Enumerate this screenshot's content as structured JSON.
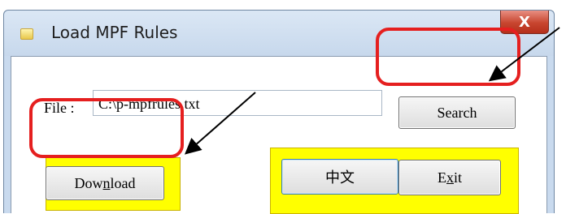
{
  "window": {
    "title": "Load MPF Rules",
    "close_glyph": "X"
  },
  "form": {
    "file_label": "File :",
    "file_value": "C:\\p-mpfrules.txt"
  },
  "buttons": {
    "search": "Search",
    "download_pre": "Dow",
    "download_mnemonic": "n",
    "download_post": "load",
    "chinese": "中文",
    "exit_pre": "E",
    "exit_mnemonic": "x",
    "exit_post": "it"
  },
  "colors": {
    "highlight_panel": "#ffff00",
    "annotation_circle": "#e51f1f"
  },
  "icons": [
    "app-icon",
    "close-icon"
  ]
}
